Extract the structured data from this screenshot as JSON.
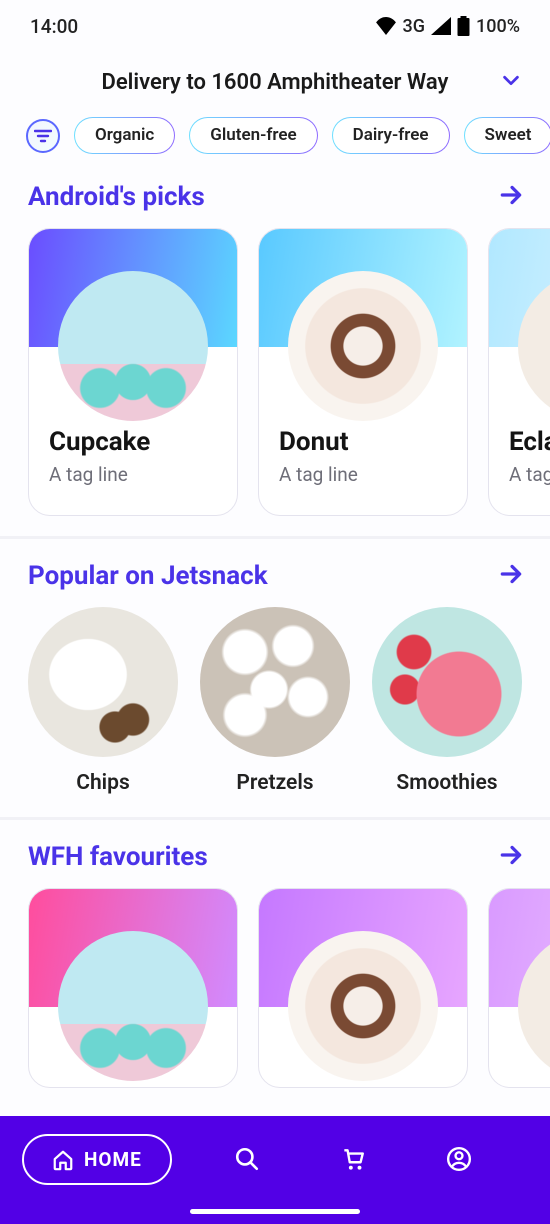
{
  "status": {
    "time": "14:00",
    "network": "3G",
    "battery": "100%"
  },
  "delivery": {
    "label": "Delivery to 1600 Amphitheater Way"
  },
  "filters": {
    "chips": [
      "Organic",
      "Gluten-free",
      "Dairy-free",
      "Sweet"
    ]
  },
  "sections": {
    "picks": {
      "title": "Android's picks",
      "items": [
        {
          "title": "Cupcake",
          "tag": "A tag line"
        },
        {
          "title": "Donut",
          "tag": "A tag line"
        },
        {
          "title": "Eclair",
          "tag": "A tag line"
        }
      ]
    },
    "popular": {
      "title": "Popular on Jetsnack",
      "items": [
        {
          "label": "Chips"
        },
        {
          "label": "Pretzels"
        },
        {
          "label": "Smoothies"
        }
      ]
    },
    "wfh": {
      "title": "WFH favourites"
    }
  },
  "nav": {
    "home": "HOME"
  }
}
